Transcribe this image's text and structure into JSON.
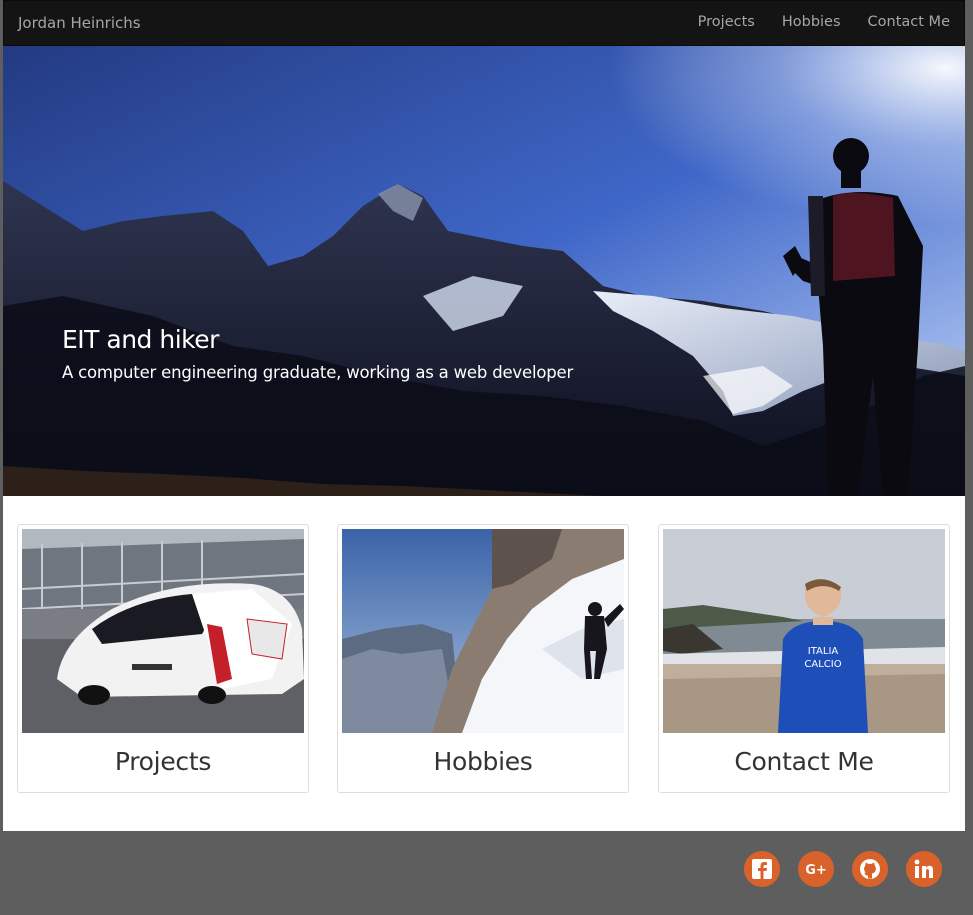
{
  "navbar": {
    "brand": "Jordan Heinrichs",
    "links": [
      {
        "label": "Projects"
      },
      {
        "label": "Hobbies"
      },
      {
        "label": "Contact Me"
      }
    ]
  },
  "hero": {
    "title": "EIT and hiker",
    "subtitle": "A computer engineering graduate, working as a web developer"
  },
  "cards": [
    {
      "caption": "Projects"
    },
    {
      "caption": "Hobbies"
    },
    {
      "caption": "Contact Me"
    }
  ],
  "footer": {
    "social": [
      {
        "icon": "facebook-icon"
      },
      {
        "icon": "google-plus-icon"
      },
      {
        "icon": "github-icon"
      },
      {
        "icon": "linkedin-icon"
      }
    ],
    "accent_color": "#d9622b"
  }
}
